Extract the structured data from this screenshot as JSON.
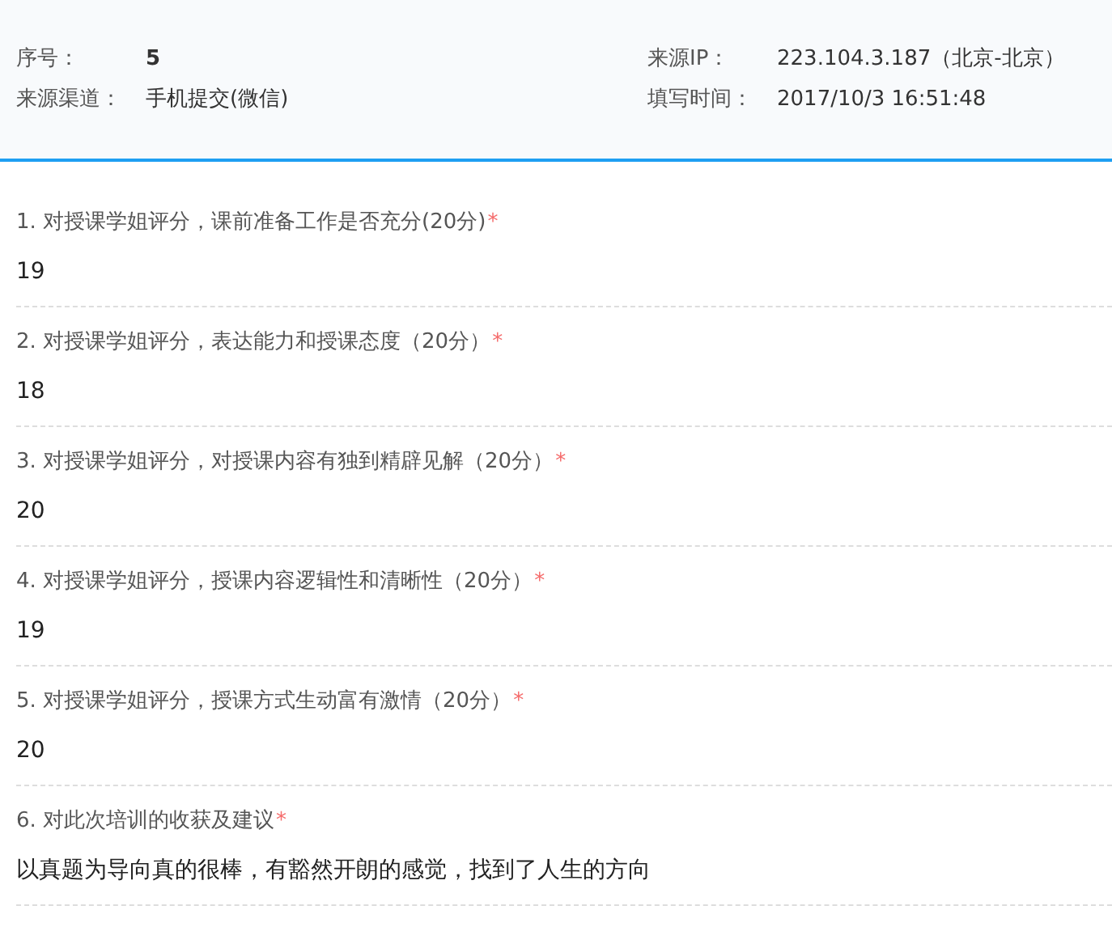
{
  "info": {
    "left": [
      {
        "label": "序号：",
        "value": "5",
        "bold": true
      },
      {
        "label": "来源渠道：",
        "value": "手机提交(微信)",
        "bold": false
      }
    ],
    "right": [
      {
        "label": "来源IP：",
        "value": "223.104.3.187（北京-北京）",
        "bold": false
      },
      {
        "label": "填写时间：",
        "value": "2017/10/3 16:51:48",
        "bold": false
      }
    ]
  },
  "questions": [
    {
      "title": "1. 对授课学姐评分，课前准备工作是否充分(20分)",
      "required_mark": "*",
      "answer": "19"
    },
    {
      "title": "2. 对授课学姐评分，表达能力和授课态度（20分）",
      "required_mark": "*",
      "answer": "18"
    },
    {
      "title": "3. 对授课学姐评分，对授课内容有独到精辟见解（20分）",
      "required_mark": "*",
      "answer": "20"
    },
    {
      "title": "4. 对授课学姐评分，授课内容逻辑性和清晰性（20分）",
      "required_mark": "*",
      "answer": "19"
    },
    {
      "title": "5. 对授课学姐评分，授课方式生动富有激情（20分）",
      "required_mark": "*",
      "answer": "20"
    },
    {
      "title": "6. 对此次培训的收获及建议",
      "required_mark": "*",
      "answer": "以真题为导向真的很棒，有豁然开朗的感觉，找到了人生的方向"
    }
  ]
}
